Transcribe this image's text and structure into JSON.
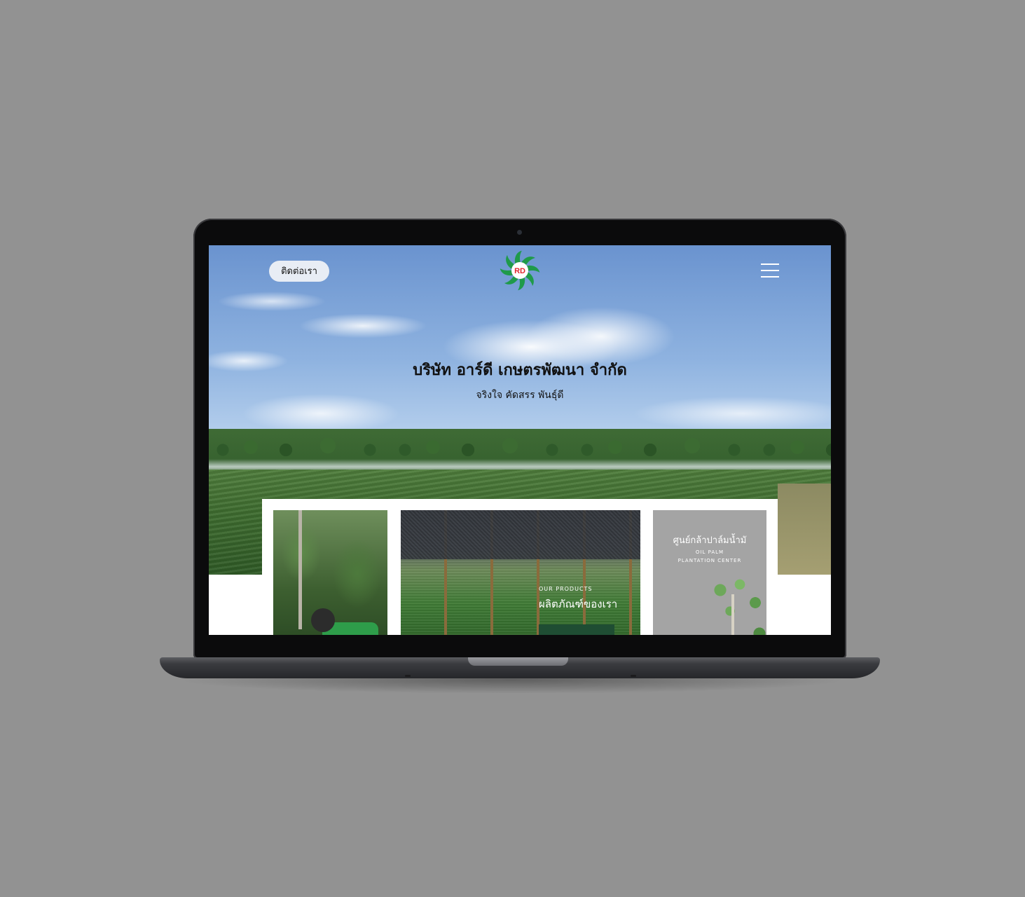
{
  "header": {
    "contact_label": "ติดต่อเรา",
    "logo_text": "RD"
  },
  "hero": {
    "title": "บริษัท อาร์ดี เกษตรพัฒนา จำกัด",
    "subtitle": "จริงใจ คัดสรร พันธุ์ดี"
  },
  "cards": {
    "products": {
      "eyebrow": "OUR PRODUCTS",
      "title": "ผลิตภัณฑ์ของเรา"
    },
    "center": {
      "title": "ศูนย์กล้าปาล์มน้ำมั",
      "en_line1": "OIL PALM",
      "en_line2": "PLANTATION CENTER"
    }
  },
  "colors": {
    "background": "#929292",
    "brand_green": "#1f9a4a",
    "brand_red": "#e0262f",
    "cta_green": "#1f4d33"
  },
  "icons": {
    "menu": "hamburger-icon",
    "logo": "rd-pinwheel-logo"
  }
}
